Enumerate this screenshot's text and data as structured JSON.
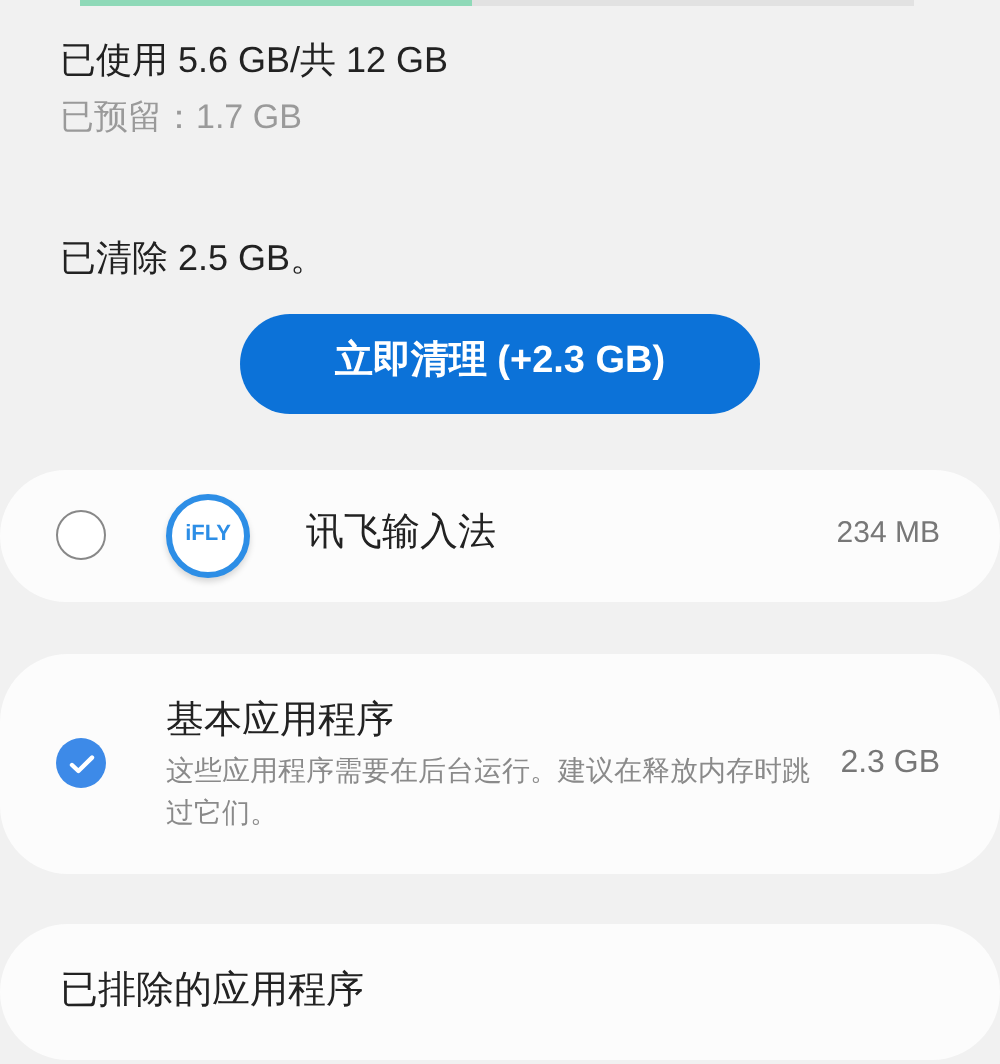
{
  "memory": {
    "level": 0.47,
    "used": "已使用 5.6 GB/共 12 GB",
    "reserved": "已预留：1.7 GB",
    "cleared": "已清除 2.5 GB。"
  },
  "clean_button": "立即清理 (+2.3 GB)",
  "apps": [
    {
      "kind": "app",
      "checked": false,
      "icon_text": "iFLY",
      "name": "讯飞输入法",
      "size": "234 MB"
    },
    {
      "kind": "group",
      "checked": true,
      "name": "基本应用程序",
      "description": "这些应用程序需要在后台运行。建议在释放内存时跳过它们。",
      "size": "2.3 GB"
    }
  ],
  "excluded": "已排除的应用程序"
}
